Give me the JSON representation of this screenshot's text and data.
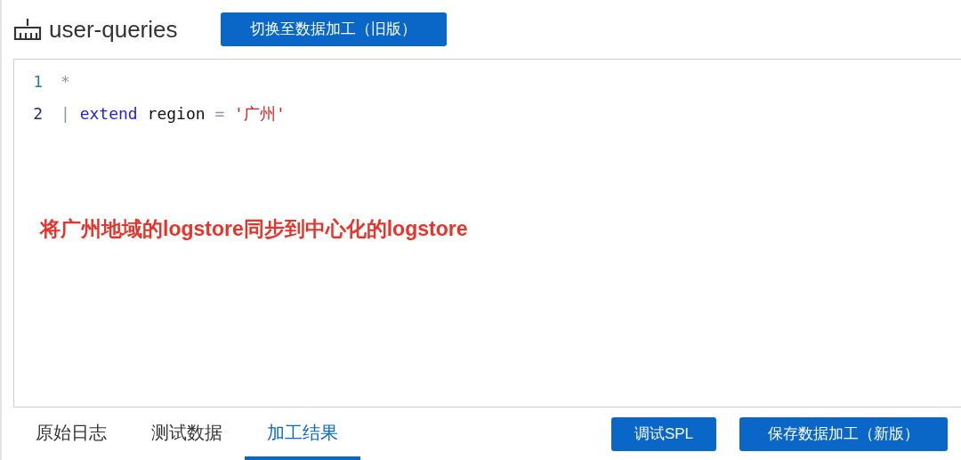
{
  "header": {
    "title": "user-queries",
    "switch_button": "切换至数据加工（旧版）"
  },
  "editor": {
    "lines": [
      {
        "number": "1",
        "active": true,
        "tokens": [
          {
            "kind": "operator",
            "text": "*"
          }
        ]
      },
      {
        "number": "2",
        "active": false,
        "tokens": [
          {
            "kind": "pipe",
            "text": "|"
          },
          {
            "kind": "keyword",
            "text": "extend"
          },
          {
            "kind": "plain",
            "text": "region"
          },
          {
            "kind": "operator",
            "text": "="
          },
          {
            "kind": "string",
            "text": "'广州'"
          }
        ]
      }
    ],
    "annotation": "将广州地域的logstore同步到中心化的logstore"
  },
  "tabs": [
    {
      "label": "原始日志",
      "selected": false
    },
    {
      "label": "测试数据",
      "selected": false
    },
    {
      "label": "加工结果",
      "selected": true
    }
  ],
  "buttons": [
    "调试SPL",
    "保存数据加工（新版）"
  ]
}
